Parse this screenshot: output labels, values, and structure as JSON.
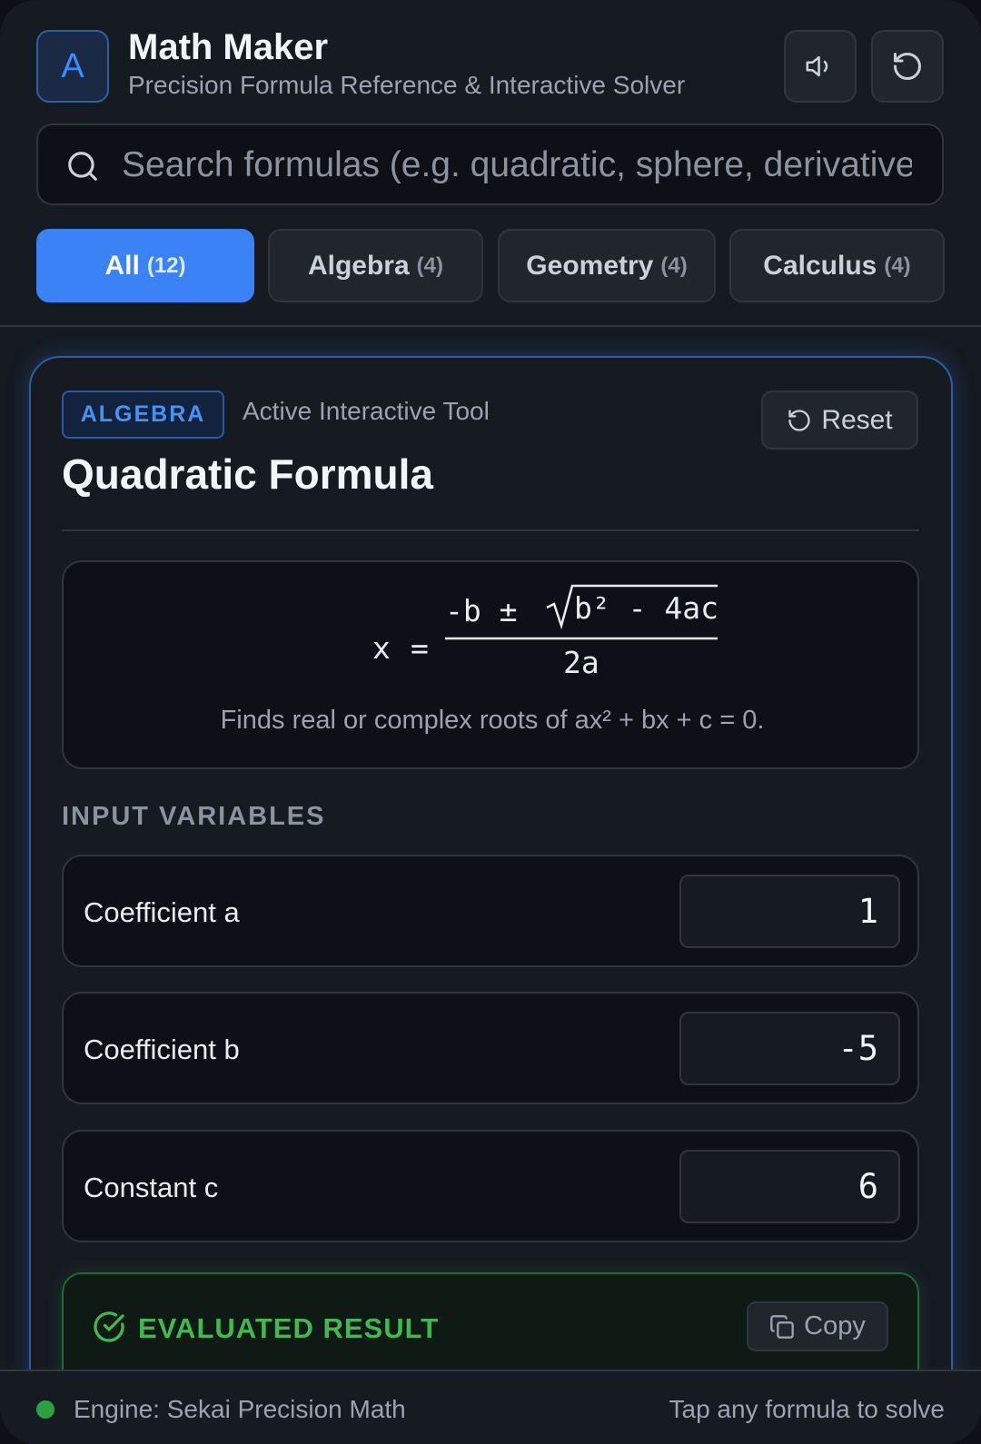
{
  "header": {
    "logo_letter": "A",
    "title": "Math Maker",
    "subtitle": "Precision Formula Reference & Interactive Solver",
    "sound_icon": "speaker-icon",
    "refresh_icon": "refresh-icon"
  },
  "search": {
    "placeholder": "Search formulas (e.g. quadratic, sphere, derivative...)",
    "value": ""
  },
  "tabs": [
    {
      "label": "All",
      "count": "(12)",
      "active": true
    },
    {
      "label": "Algebra",
      "count": "(4)",
      "active": false
    },
    {
      "label": "Geometry",
      "count": "(4)",
      "active": false
    },
    {
      "label": "Calculus",
      "count": "(4)",
      "active": false
    }
  ],
  "card": {
    "badge": "ALGEBRA",
    "active_label": "Active Interactive Tool",
    "reset_label": "Reset",
    "title": "Quadratic Formula",
    "formula": {
      "lhs": "x",
      "eq": "=",
      "numerator_left": "-b ±",
      "radicand": "b² - 4ac",
      "denominator": "2a",
      "description": "Finds real or complex roots of ax² + bx + c = 0."
    },
    "section_label": "INPUT VARIABLES",
    "variables": [
      {
        "label": "Coefficient a",
        "value": "1"
      },
      {
        "label": "Coefficient b",
        "value": "-5"
      },
      {
        "label": "Constant c",
        "value": "6"
      }
    ],
    "result": {
      "label": "EVALUATED RESULT",
      "copy_label": "Copy"
    }
  },
  "footer": {
    "engine": "Engine: Sekai Precision Math",
    "hint": "Tap any formula to solve"
  },
  "colors": {
    "accent": "#3b82f6",
    "success": "#3fb950",
    "background": "#161b22"
  }
}
